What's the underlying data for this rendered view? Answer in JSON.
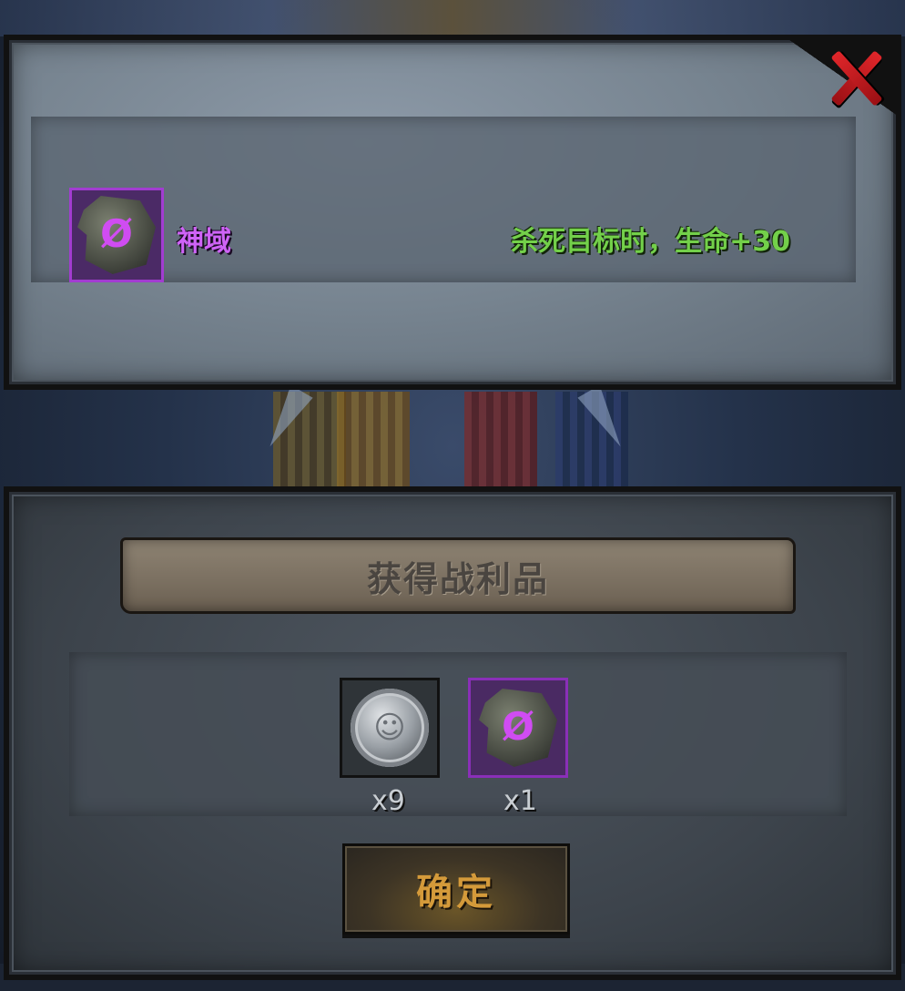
{
  "top_panel": {
    "item": {
      "name": "神域",
      "icon": "rune-stone-icon",
      "glyph": "Ø",
      "rarity_color": "#cf63f7"
    },
    "effect": "杀死目标时，生命+30",
    "effect_color": "#73d04a"
  },
  "bottom_panel": {
    "title": "获得战利品",
    "rewards": [
      {
        "icon": "silver-coin-icon",
        "glyph": "☺",
        "quantity": "x9"
      },
      {
        "icon": "rune-stone-icon",
        "glyph": "Ø",
        "quantity": "x1"
      }
    ],
    "confirm_label": "确定"
  },
  "colors": {
    "close_button": "#e0262a",
    "confirm_text": "#d49a3a",
    "purple_rarity": "#a23cd1"
  }
}
